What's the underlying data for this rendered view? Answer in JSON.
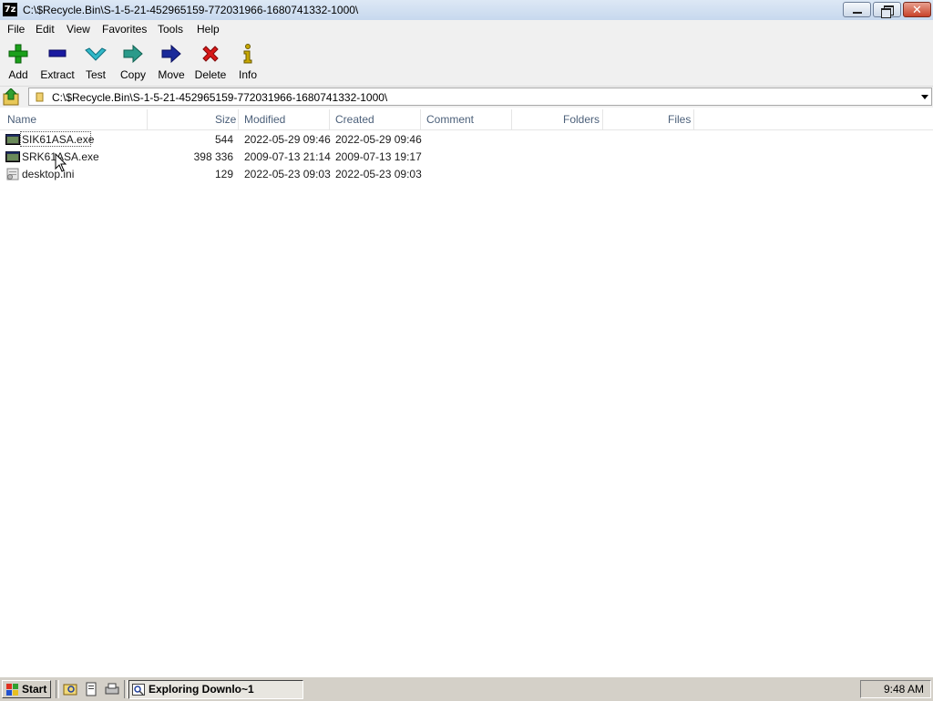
{
  "window": {
    "app_icon_text": "7z",
    "title": "C:\\$Recycle.Bin\\S-1-5-21-452965159-772031966-1680741332-1000\\"
  },
  "menu": [
    "File",
    "Edit",
    "View",
    "Favorites",
    "Tools",
    "Help"
  ],
  "toolbar": {
    "add": "Add",
    "extract": "Extract",
    "test": "Test",
    "copy": "Copy",
    "move": "Move",
    "delete": "Delete",
    "info": "Info"
  },
  "address": {
    "path": "C:\\$Recycle.Bin\\S-1-5-21-452965159-772031966-1680741332-1000\\"
  },
  "columns": {
    "name": "Name",
    "size": "Size",
    "modified": "Modified",
    "created": "Created",
    "comment": "Comment",
    "folders": "Folders",
    "files": "Files"
  },
  "files": [
    {
      "name": "SIK61ASA.exe",
      "size": "544",
      "modified": "2022-05-29 09:46",
      "created": "2022-05-29 09:46",
      "icon": "exe-icon"
    },
    {
      "name": "SRK61ASA.exe",
      "size": "398 336",
      "modified": "2009-07-13 21:14",
      "created": "2009-07-13 19:17",
      "icon": "exe-icon"
    },
    {
      "name": "desktop.ini",
      "size": "129",
      "modified": "2022-05-23 09:03",
      "created": "2022-05-23 09:03",
      "icon": "ini-file-icon"
    }
  ],
  "taskbar": {
    "start": "Start",
    "task": "Exploring Downlo~1",
    "clock": "9:48 AM"
  },
  "colors": {
    "add": "#1aa01a",
    "extract": "#1a1aa0",
    "test": "#30b8c8",
    "copy": "#2a9a8a",
    "move": "#1a2a9a",
    "delete": "#d81818",
    "info": "#c8a800"
  }
}
